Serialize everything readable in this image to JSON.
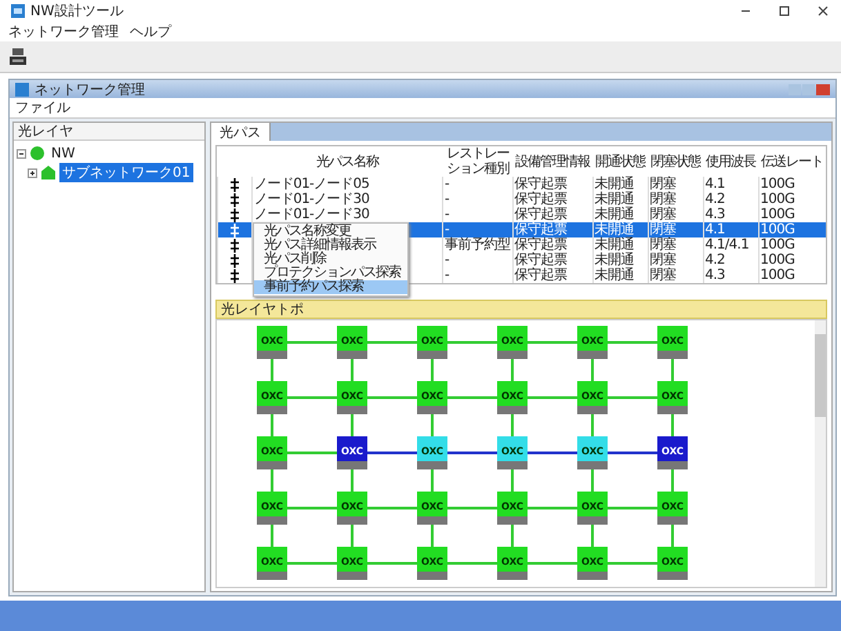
{
  "window": {
    "title": "NW設計ツール"
  },
  "menu": [
    "ネットワーク管理",
    "ヘルプ"
  ],
  "inner_window": {
    "title": "ネットワーク管理",
    "menu": [
      "ファイル"
    ]
  },
  "sidebar": {
    "title": "光レイヤ",
    "tree": [
      {
        "label": "NW",
        "expanded": true,
        "selected": false,
        "children": [
          {
            "label": "サブネットワーク01",
            "expanded": false,
            "selected": true
          }
        ]
      }
    ]
  },
  "tabs": [
    {
      "label": "光パス",
      "selected": true
    }
  ],
  "table": {
    "columns": [
      "光パス名称",
      "レストレーション種別",
      "設備管理情報",
      "開通状態",
      "閉塞状態",
      "使用波長",
      "伝送レート"
    ],
    "rows": [
      {
        "selected": false,
        "cells": [
          "ノード01-ノード05",
          "-",
          "保守起票",
          "未開通",
          "閉塞",
          "4.1",
          "100G"
        ]
      },
      {
        "selected": false,
        "cells": [
          "ノード01-ノード30",
          "-",
          "保守起票",
          "未開通",
          "閉塞",
          "4.2",
          "100G"
        ]
      },
      {
        "selected": false,
        "cells": [
          "ノード01-ノード30",
          "-",
          "保守起票",
          "未開通",
          "閉塞",
          "4.3",
          "100G"
        ]
      },
      {
        "selected": true,
        "cells": [
          "",
          "-",
          "保守起票",
          "未開通",
          "閉塞",
          "4.1",
          "100G"
        ]
      },
      {
        "selected": false,
        "cells": [
          "",
          "事前予約型",
          "保守起票",
          "未開通",
          "閉塞",
          "4.1/4.1",
          "100G"
        ]
      },
      {
        "selected": false,
        "cells": [
          "",
          "-",
          "保守起票",
          "未開通",
          "閉塞",
          "4.2",
          "100G"
        ]
      },
      {
        "selected": false,
        "cells": [
          "",
          "-",
          "保守起票",
          "未開通",
          "閉塞",
          "4.3",
          "100G"
        ]
      }
    ]
  },
  "context_menu": [
    {
      "label": "光パス名称変更",
      "selected": false
    },
    {
      "label": "光パス詳細情報表示",
      "selected": false
    },
    {
      "label": "光パス削除",
      "selected": false
    },
    {
      "label": "プロテクションパス探索",
      "selected": false
    },
    {
      "label": "事前予約パス探索",
      "selected": true
    }
  ],
  "topology": {
    "title": "光レイヤトポ",
    "rows": [
      {
        "links": [
          {
            "color": "#33cc33"
          },
          {
            "color": "#33cc33"
          },
          {
            "color": "#33cc33"
          },
          {
            "color": "#33cc33"
          },
          {
            "color": "#33cc33"
          }
        ],
        "nodes": [
          {
            "label": "OXC",
            "color": "#22dd22"
          },
          {
            "label": "OXC",
            "color": "#22dd22"
          },
          {
            "label": "OXC",
            "color": "#22dd22"
          },
          {
            "label": "OXC",
            "color": "#22dd22"
          },
          {
            "label": "OXC",
            "color": "#22dd22"
          },
          {
            "label": "OXC",
            "color": "#22dd22"
          }
        ]
      },
      {
        "links": [
          {
            "color": "#33cc33"
          },
          {
            "color": "#33cc33"
          },
          {
            "color": "#33cc33"
          },
          {
            "color": "#33cc33"
          },
          {
            "color": "#33cc33"
          }
        ],
        "nodes": [
          {
            "label": "OXC",
            "color": "#22dd22"
          },
          {
            "label": "OXC",
            "color": "#22dd22"
          },
          {
            "label": "OXC",
            "color": "#22dd22"
          },
          {
            "label": "OXC",
            "color": "#22dd22"
          },
          {
            "label": "OXC",
            "color": "#22dd22"
          },
          {
            "label": "OXC",
            "color": "#22dd22"
          }
        ]
      },
      {
        "links": [
          {
            "color": "#33cc33"
          },
          {
            "color": "#2233cc"
          },
          {
            "color": "#2233cc"
          },
          {
            "color": "#2233cc"
          },
          {
            "color": "#2233cc"
          }
        ],
        "nodes": [
          {
            "label": "OXC",
            "color": "#22dd22"
          },
          {
            "label": "OXC",
            "color": "#1a1acc"
          },
          {
            "label": "OXC",
            "color": "#33dde8"
          },
          {
            "label": "OXC",
            "color": "#33dde8"
          },
          {
            "label": "OXC",
            "color": "#33dde8"
          },
          {
            "label": "OXC",
            "color": "#1a1acc"
          }
        ]
      },
      {
        "links": [
          {
            "color": "#33cc33"
          },
          {
            "color": "#33cc33"
          },
          {
            "color": "#33cc33"
          },
          {
            "color": "#33cc33"
          },
          {
            "color": "#33cc33"
          }
        ],
        "nodes": [
          {
            "label": "OXC",
            "color": "#22dd22"
          },
          {
            "label": "OXC",
            "color": "#22dd22"
          },
          {
            "label": "OXC",
            "color": "#22dd22"
          },
          {
            "label": "OXC",
            "color": "#22dd22"
          },
          {
            "label": "OXC",
            "color": "#22dd22"
          },
          {
            "label": "OXC",
            "color": "#22dd22"
          }
        ]
      },
      {
        "links": [
          {
            "color": "#33cc33"
          },
          {
            "color": "#33cc33"
          },
          {
            "color": "#33cc33"
          },
          {
            "color": "#33cc33"
          },
          {
            "color": "#33cc33"
          }
        ],
        "nodes": [
          {
            "label": "OXC",
            "color": "#22dd22"
          },
          {
            "label": "OXC",
            "color": "#22dd22"
          },
          {
            "label": "OXC",
            "color": "#22dd22"
          },
          {
            "label": "OXC",
            "color": "#22dd22"
          },
          {
            "label": "OXC",
            "color": "#22dd22"
          },
          {
            "label": "OXC",
            "color": "#22dd22"
          }
        ]
      }
    ]
  }
}
